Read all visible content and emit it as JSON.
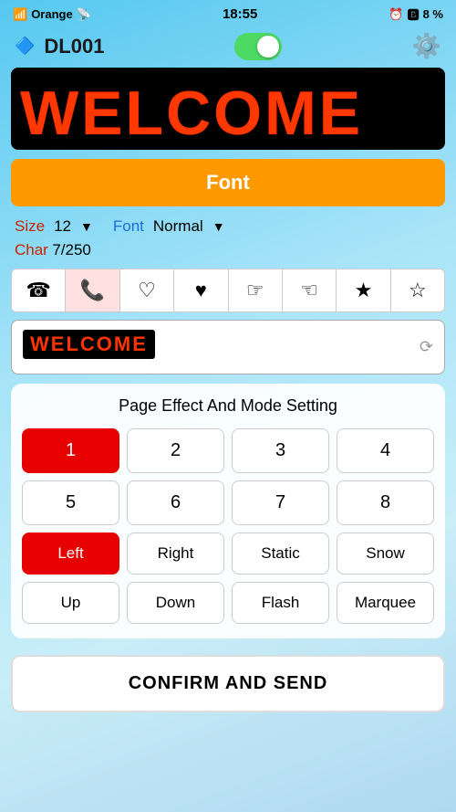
{
  "statusBar": {
    "carrier": "Orange",
    "time": "18:55",
    "alarm": "⏰",
    "bluetooth": "🔵",
    "battery": "8 %"
  },
  "topBar": {
    "deviceName": "DL001",
    "toggleState": true,
    "gearLabel": "Settings"
  },
  "ledDisplay": {
    "text": "WELCOME"
  },
  "fontButton": {
    "label": "Font"
  },
  "sizeFontRow": {
    "sizeLabel": "Size",
    "sizeValue": "12",
    "dropdownArrow": "▼",
    "fontLabel": "Font",
    "fontValue": "Normal",
    "fontDropdownArrow": "▼"
  },
  "charRow": {
    "label": "Char",
    "value": "7/250"
  },
  "emojiRow": [
    {
      "symbol": "☎",
      "active": false
    },
    {
      "symbol": "📞",
      "active": true
    },
    {
      "symbol": "♡",
      "active": false
    },
    {
      "symbol": "♥",
      "active": false
    },
    {
      "symbol": "☞",
      "active": false
    },
    {
      "symbol": "☜",
      "active": false
    },
    {
      "symbol": "★",
      "active": false
    },
    {
      "symbol": "☆",
      "active": false
    }
  ],
  "textInput": {
    "value": "WELCOME",
    "cursorIcon": "⟳"
  },
  "effectPanel": {
    "title": "Page Effect And Mode Setting",
    "buttons": [
      {
        "label": "1",
        "active": true
      },
      {
        "label": "2",
        "active": false
      },
      {
        "label": "3",
        "active": false
      },
      {
        "label": "4",
        "active": false
      },
      {
        "label": "5",
        "active": false
      },
      {
        "label": "6",
        "active": false
      },
      {
        "label": "7",
        "active": false
      },
      {
        "label": "8",
        "active": false
      },
      {
        "label": "Left",
        "active": true
      },
      {
        "label": "Right",
        "active": false
      },
      {
        "label": "Static",
        "active": false
      },
      {
        "label": "Snow",
        "active": false
      },
      {
        "label": "Up",
        "active": false
      },
      {
        "label": "Down",
        "active": false
      },
      {
        "label": "Flash",
        "active": false
      },
      {
        "label": "Marquee",
        "active": false
      }
    ]
  },
  "confirmBtn": {
    "label": "CONFIRM AND SEND"
  }
}
